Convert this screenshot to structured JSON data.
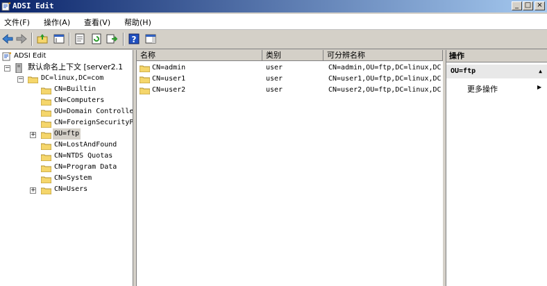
{
  "window": {
    "title": "ADSI Edit"
  },
  "menu": [
    {
      "label": "文件(F)"
    },
    {
      "label": "操作(A)"
    },
    {
      "label": "查看(V)"
    },
    {
      "label": "帮助(H)"
    }
  ],
  "toolbar": {
    "buttons": [
      "back-icon",
      "forward-icon",
      "up-folder-icon",
      "show-hide-tree-icon",
      "properties-icon",
      "refresh-icon",
      "export-list-icon",
      "help-icon",
      "show-action-pane-icon"
    ]
  },
  "tree": {
    "root": "ADSI Edit",
    "context": "默认命名上下文 [server2.1",
    "domain": "DC=linux,DC=com",
    "items": [
      {
        "label": "CN=Builtin"
      },
      {
        "label": "CN=Computers"
      },
      {
        "label": "OU=Domain Controlle"
      },
      {
        "label": "CN=ForeignSecurityP"
      },
      {
        "label": "OU=ftp"
      },
      {
        "label": "CN=LostAndFound"
      },
      {
        "label": "CN=NTDS Quotas"
      },
      {
        "label": "CN=Program Data"
      },
      {
        "label": "CN=System"
      },
      {
        "label": "CN=Users"
      }
    ]
  },
  "list": {
    "columns": [
      "名称",
      "类别",
      "可分辨名称"
    ],
    "rows": [
      {
        "name": "CN=admin",
        "type": "user",
        "dn": "CN=admin,OU=ftp,DC=linux,DC"
      },
      {
        "name": "CN=user1",
        "type": "user",
        "dn": "CN=user1,OU=ftp,DC=linux,DC"
      },
      {
        "name": "CN=user2",
        "type": "user",
        "dn": "CN=user2,OU=ftp,DC=linux,DC"
      }
    ]
  },
  "actions": {
    "title": "操作",
    "section": "OU=ftp",
    "more": "更多操作"
  },
  "colors": {
    "title_start": "#0a246a",
    "title_end": "#a6caf0",
    "folder": "#f5d66b",
    "selection": "#d4d0c8"
  }
}
